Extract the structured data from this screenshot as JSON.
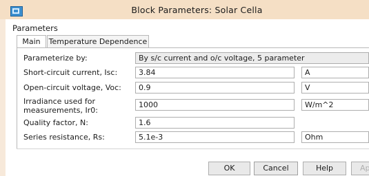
{
  "window": {
    "title": "Block Parameters: Solar Cella"
  },
  "parameters": {
    "group_label": "Parameters",
    "tabs": [
      {
        "label": "Main"
      },
      {
        "label": "Temperature Dependence"
      }
    ],
    "parameterize": {
      "label": "Parameterize by:",
      "value": "By s/c current and o/c voltage, 5 parameter"
    },
    "rows": [
      {
        "label": "Short-circuit current, Isc:",
        "value": "3.84",
        "unit": "A"
      },
      {
        "label": "Open-circuit voltage, Voc:",
        "value": "0.9",
        "unit": "V"
      },
      {
        "label_line1": "Irradiance used for",
        "label_line2": "measurements, Ir0:",
        "value": "1000",
        "unit": "W/m^2"
      },
      {
        "label": "Quality factor, N:",
        "value": "1.6"
      },
      {
        "label": "Series resistance, Rs:",
        "value": "5.1e-3",
        "unit": "Ohm"
      }
    ]
  },
  "buttons": {
    "ok": "OK",
    "cancel": "Cancel",
    "help": "Help",
    "apply_partial": "Ap"
  }
}
